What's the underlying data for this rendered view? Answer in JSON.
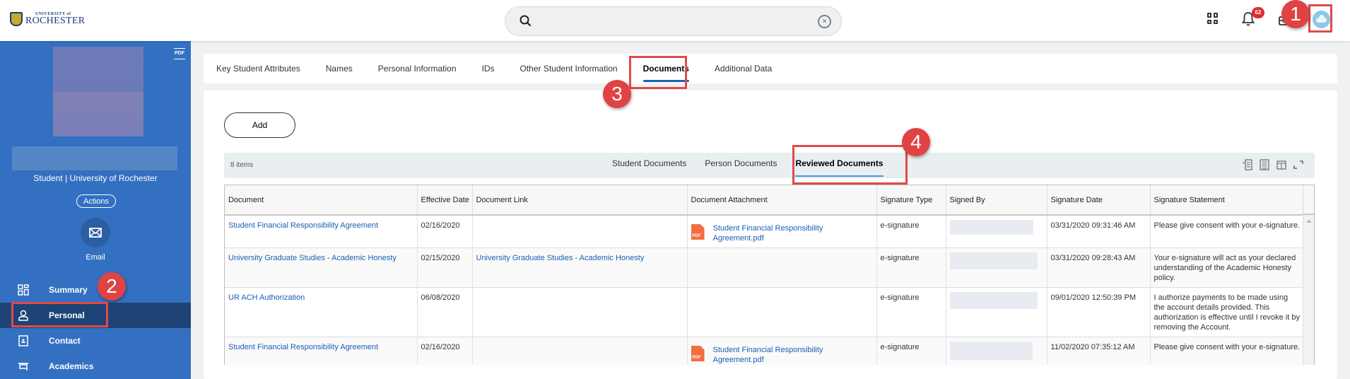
{
  "app": {
    "logo_small": "UNIVERSITY of",
    "logo_big": "ROCHESTER"
  },
  "search": {
    "value": "",
    "placeholder": ""
  },
  "topbar": {
    "notifications_count": "62",
    "icons": [
      "apps-grid-icon",
      "bell-icon",
      "inbox-icon",
      "avatar-cloud-icon"
    ]
  },
  "callouts": [
    "1",
    "2",
    "3",
    "4"
  ],
  "sidebar": {
    "role": "Student | University of Rochester",
    "actions_label": "Actions",
    "email_label": "Email",
    "pdf_label": "PDF",
    "items": [
      {
        "label": "Summary",
        "icon": "dashboard-icon",
        "active": false
      },
      {
        "label": "Personal",
        "icon": "person-icon",
        "active": true
      },
      {
        "label": "Contact",
        "icon": "contact-card-icon",
        "active": false
      },
      {
        "label": "Academics",
        "icon": "mortarboard-icon",
        "active": false
      }
    ]
  },
  "tabs": [
    {
      "label": "Key Student Attributes",
      "active": false
    },
    {
      "label": "Names",
      "active": false
    },
    {
      "label": "Personal Information",
      "active": false
    },
    {
      "label": "IDs",
      "active": false
    },
    {
      "label": "Other Student Information",
      "active": false
    },
    {
      "label": "Documents",
      "active": true
    },
    {
      "label": "Additional Data",
      "active": false
    }
  ],
  "content": {
    "add_label": "Add",
    "items_count": "8 items",
    "subtabs": [
      {
        "label": "Student Documents",
        "active": false
      },
      {
        "label": "Person Documents",
        "active": false
      },
      {
        "label": "Reviewed Documents",
        "active": true
      }
    ],
    "grid_tools": [
      "export-excel-icon",
      "print-icon",
      "column-layout-icon",
      "fullscreen-icon"
    ],
    "columns": [
      "Document",
      "Effective Date",
      "Document Link",
      "Document Attachment",
      "Signature Type",
      "Signed By",
      "Signature Date",
      "Signature Statement"
    ],
    "rows": [
      {
        "document": "Student Financial Responsibility Agreement",
        "effective_date": "02/16/2020",
        "document_link": "",
        "attachment": "Student Financial Responsibility Agreement.pdf",
        "signature_type": "e-signature",
        "signed_by": "",
        "signature_date": "03/31/2020 09:31:46 AM",
        "statement": "Please give consent with your e-signature."
      },
      {
        "document": "University Graduate Studies - Academic Honesty",
        "effective_date": "02/15/2020",
        "document_link": "University Graduate Studies - Academic Honesty",
        "attachment": "",
        "signature_type": "e-signature",
        "signed_by": "",
        "signature_date": "03/31/2020 09:28:43 AM",
        "statement": "Your e-signature will act as your declared understanding of the Academic Honesty policy."
      },
      {
        "document": "UR ACH Authorization",
        "effective_date": "06/08/2020",
        "document_link": "",
        "attachment": "",
        "signature_type": "e-signature",
        "signed_by": "",
        "signature_date": "09/01/2020 12:50:39 PM",
        "statement": "I authorize payments to be made using the account details provided. This authorization is effective until I revoke it by removing the Account."
      },
      {
        "document": "Student Financial Responsibility Agreement",
        "effective_date": "02/16/2020",
        "document_link": "",
        "attachment": "Student Financial Responsibility Agreement.pdf",
        "signature_type": "e-signature",
        "signed_by": "",
        "signature_date": "11/02/2020 07:35:12 AM",
        "statement": "Please give consent with your e-signature."
      }
    ]
  }
}
